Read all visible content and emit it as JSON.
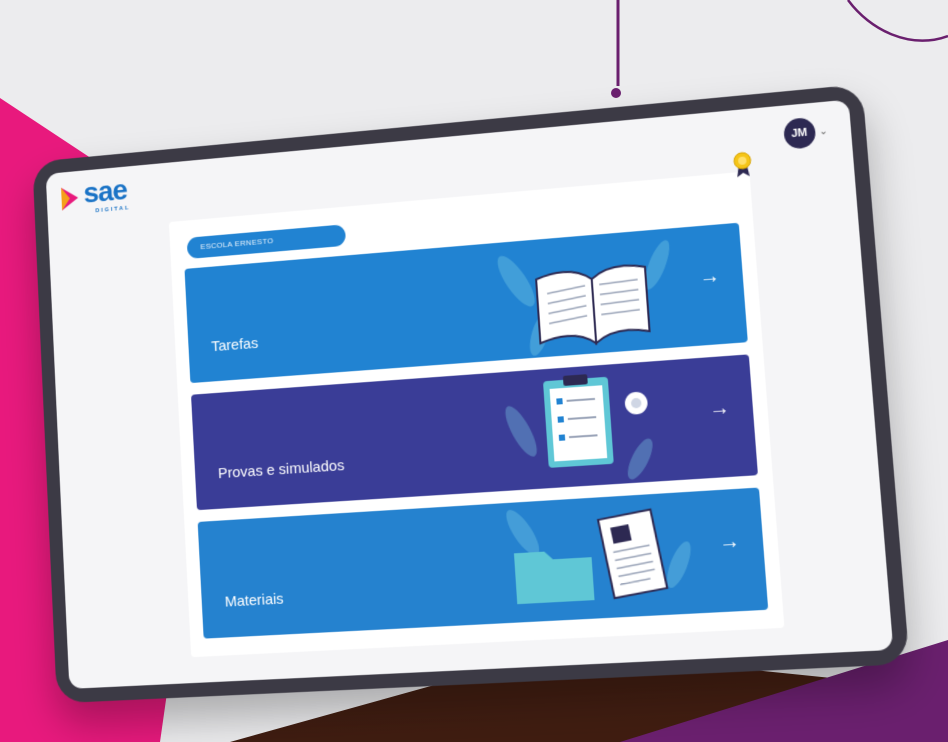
{
  "logo": {
    "text": "sae",
    "subtitle": "DIGITAL"
  },
  "user": {
    "initials": "JM"
  },
  "school": {
    "label": "ESCOLA ERNESTO"
  },
  "cards": [
    {
      "label": "Tarefas"
    },
    {
      "label": "Provas e simulados"
    },
    {
      "label": "Materiais"
    }
  ],
  "colors": {
    "pink": "#e8197d",
    "purple_line": "#6a1f6e",
    "card_blue": "#2183d2",
    "card_indigo": "#3a3d97",
    "avatar": "#2d2952"
  },
  "icons": [
    "award-icon",
    "chevron-down-icon",
    "arrow-right-icon",
    "open-book-icon",
    "checklist-clipboard-icon",
    "folder-document-icon"
  ]
}
